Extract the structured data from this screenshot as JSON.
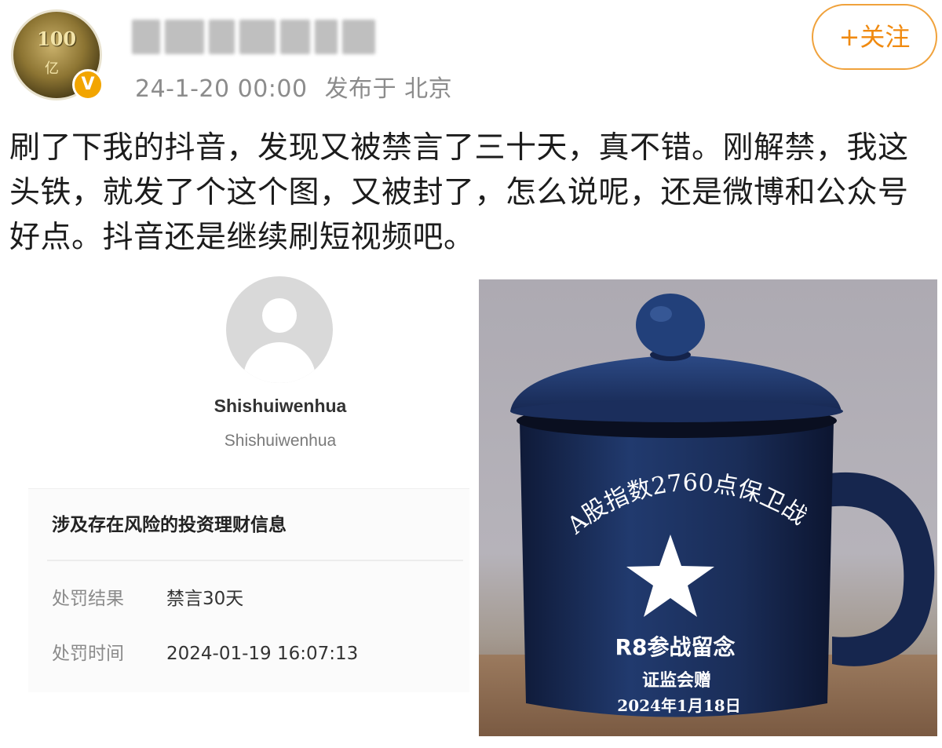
{
  "post": {
    "timestamp": "24-1-20 00:00",
    "location": "发布于 北京",
    "follow_label": "+关注",
    "verified_badge": "V",
    "body": "刷了下我的抖音，发现又被禁言了三十天，真不错。刚解禁，我这头铁，就发了个这个图，又被封了，怎么说呢，还是微博和公众号好点。抖音还是继续刷短视频吧。",
    "avatar_coin_text": "100",
    "avatar_coin_sub": "亿"
  },
  "screenshot": {
    "account_name": "Shishuiwenhua",
    "account_handle": "Shishuiwenhua",
    "violation_title": "涉及存在风险的投资理财信息",
    "rows": [
      {
        "label": "处罚结果",
        "value": "禁言30天"
      },
      {
        "label": "处罚时间",
        "value": "2024-01-19 16:07:13"
      }
    ]
  },
  "mug": {
    "arc_text": "A股指数2760点保卫战",
    "line1": "R8参战留念",
    "line2": "证监会赠",
    "line3": "2024年1月18日"
  },
  "colors": {
    "follow_accent": "#f08a10",
    "verified_badge": "#f2a500",
    "mug_blue": "#1c2f5c"
  }
}
